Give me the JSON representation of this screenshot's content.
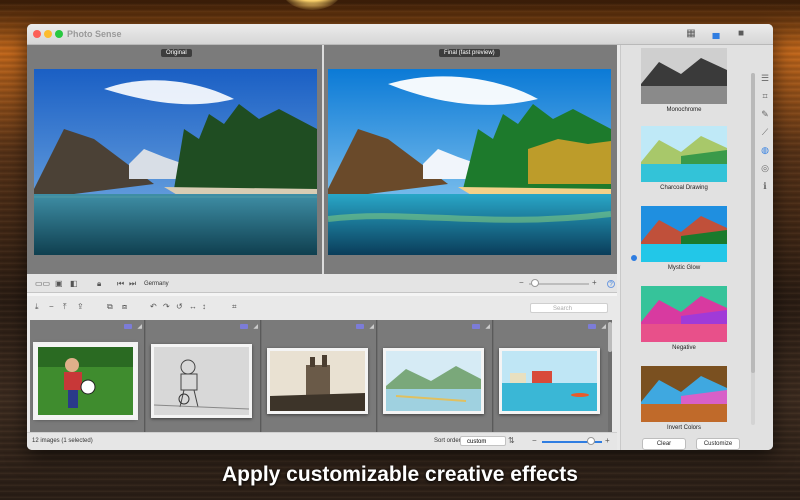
{
  "app": {
    "title": "Photo Sense"
  },
  "preview": {
    "original_label": "Original",
    "final_label": "Final (fast preview)",
    "location": "Germany",
    "help": "?"
  },
  "browser": {
    "search_placeholder": "Search",
    "status": "12 images (1 selected)",
    "sort_label": "Sort order:",
    "sort_value": "custom"
  },
  "effects": [
    {
      "label": "Monochrome"
    },
    {
      "label": "Charcoal Drawing"
    },
    {
      "label": "Mystic Glow"
    },
    {
      "label": "Negative"
    },
    {
      "label": "Invert Colors"
    }
  ],
  "buttons": {
    "clear": "Clear",
    "customize": "Customize"
  },
  "caption": "Apply customizable creative effects",
  "colors": {
    "accent": "#2f7de1",
    "badge": "#7c7cd8"
  }
}
